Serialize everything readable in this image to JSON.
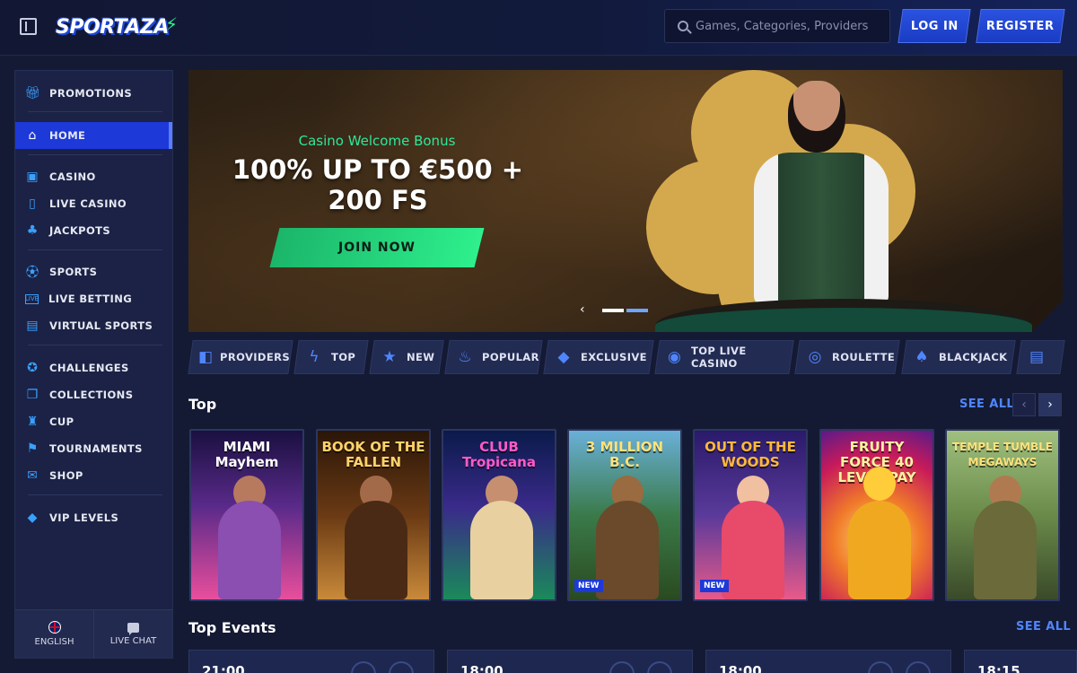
{
  "header": {
    "logo_text": "SPORTAZA",
    "search_placeholder": "Games, Categories, Providers",
    "login_label": "LOG IN",
    "register_label": "REGISTER"
  },
  "sidebar": {
    "items": [
      {
        "label": "PROMOTIONS",
        "icon": "gift-icon"
      },
      {
        "label": "HOME",
        "icon": "home-icon",
        "active": true
      },
      {
        "label": "CASINO",
        "icon": "slot-machine-icon"
      },
      {
        "label": "LIVE CASINO",
        "icon": "card-icon"
      },
      {
        "label": "JACKPOTS",
        "icon": "clover-icon"
      },
      {
        "label": "SPORTS",
        "icon": "football-icon"
      },
      {
        "label": "LIVE BETTING",
        "icon": "live-icon"
      },
      {
        "label": "VIRTUAL SPORTS",
        "icon": "virtual-icon"
      },
      {
        "label": "CHALLENGES",
        "icon": "medal-icon"
      },
      {
        "label": "COLLECTIONS",
        "icon": "cards-icon"
      },
      {
        "label": "CUP",
        "icon": "trophy-icon"
      },
      {
        "label": "TOURNAMENTS",
        "icon": "flag-checkered-icon"
      },
      {
        "label": "SHOP",
        "icon": "shop-icon"
      },
      {
        "label": "VIP LEVELS",
        "icon": "diamond-icon"
      }
    ],
    "footer": {
      "language_label": "ENGLISH",
      "chat_label": "LIVE CHAT"
    }
  },
  "banner": {
    "subtitle": "Casino Welcome Bonus",
    "title": "100% UP TO €500 + 200 FS",
    "cta_label": "JOIN NOW",
    "slides": 2,
    "active_slide": 1
  },
  "categories": [
    {
      "label": "PROVIDERS",
      "icon": "providers-icon"
    },
    {
      "label": "TOP",
      "icon": "lightning-icon"
    },
    {
      "label": "NEW",
      "icon": "star-icon"
    },
    {
      "label": "POPULAR",
      "icon": "fire-icon"
    },
    {
      "label": "EXCLUSIVE",
      "icon": "diamond-icon"
    },
    {
      "label": "TOP LIVE CASINO",
      "icon": "chips-icon"
    },
    {
      "label": "ROULETTE",
      "icon": "roulette-icon"
    },
    {
      "label": "BLACKJACK",
      "icon": "blackjack-icon"
    }
  ],
  "top_section": {
    "title": "Top",
    "see_all": "SEE ALL",
    "games": [
      {
        "title": "MIAMI Mayhem",
        "badge": ""
      },
      {
        "title": "BOOK OF THE FALLEN",
        "badge": ""
      },
      {
        "title": "CLUB Tropicana",
        "badge": ""
      },
      {
        "title": "3 MILLION B.C.",
        "badge": "NEW"
      },
      {
        "title": "OUT OF THE WOODS",
        "badge": "NEW"
      },
      {
        "title": "FRUITY FORCE 40 LEVEL PAY",
        "badge": ""
      },
      {
        "title": "TEMPLE TUMBLE MEGAWAYS",
        "badge": ""
      }
    ]
  },
  "events_section": {
    "title": "Top Events",
    "see_all": "SEE ALL",
    "times": [
      "21:00",
      "18:00",
      "18:00",
      "18:15"
    ]
  },
  "colors": {
    "accent_blue": "#1d39d8",
    "accent_green": "#2ee89a",
    "link_blue": "#4f86ff"
  }
}
